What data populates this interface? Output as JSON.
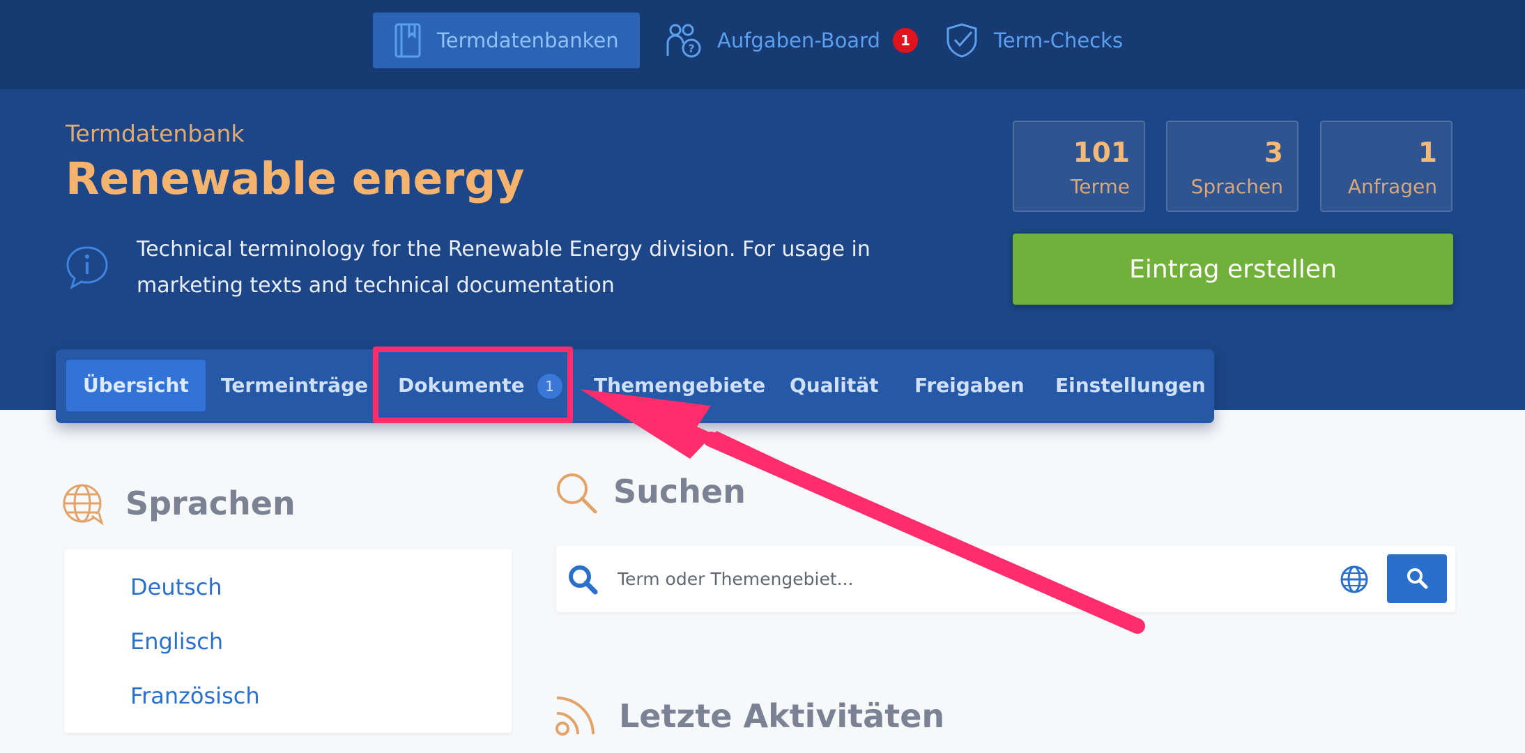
{
  "topnav": {
    "items": [
      {
        "label": "Termdatenbanken",
        "icon": "book-icon"
      },
      {
        "label": "Aufgaben-Board",
        "icon": "users-question-icon",
        "badge": "1"
      },
      {
        "label": "Term-Checks",
        "icon": "shield-check-icon"
      }
    ]
  },
  "hero": {
    "label": "Termdatenbank",
    "title": "Renewable energy",
    "description": "Technical terminology for the Renewable Energy division. For usage in marketing texts and technical documentation",
    "stats": [
      {
        "value": "101",
        "label": "Terme"
      },
      {
        "value": "3",
        "label": "Sprachen"
      },
      {
        "value": "1",
        "label": "Anfragen"
      }
    ],
    "create_label": "Eintrag erstellen"
  },
  "tabs": [
    {
      "label": "Übersicht"
    },
    {
      "label": "Termeinträge"
    },
    {
      "label": "Dokumente",
      "badge": "1"
    },
    {
      "label": "Themengebiete"
    },
    {
      "label": "Qualität"
    },
    {
      "label": "Freigaben"
    },
    {
      "label": "Einstellungen"
    }
  ],
  "languages": {
    "title": "Sprachen",
    "items": [
      "Deutsch",
      "Englisch",
      "Französisch"
    ]
  },
  "search": {
    "title": "Suchen",
    "placeholder": "Term oder Themengebiet..."
  },
  "activities": {
    "title": "Letzte Aktivitäten"
  },
  "colors": {
    "nav_bg": "#173a73",
    "hero_bg": "#1c4687",
    "accent_orange": "#f6b36e",
    "primary_blue": "#2a6fcb",
    "create_green": "#71b03a",
    "annotation_pink": "#ff2d6b"
  }
}
